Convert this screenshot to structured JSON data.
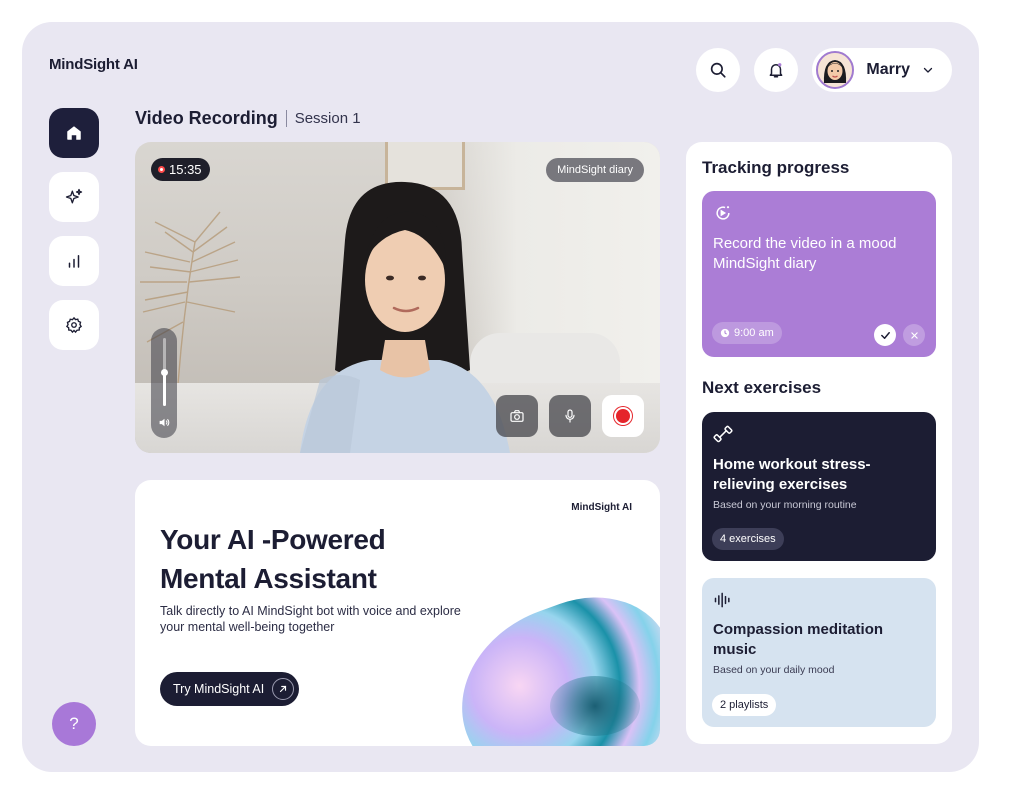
{
  "app": {
    "brand": "MindSight AI"
  },
  "header": {
    "user_name": "Marry"
  },
  "page": {
    "title": "Video Recording",
    "subtitle": "Session 1"
  },
  "video": {
    "timer": "15:35",
    "badge": "MindSight diary",
    "volume_level": 0.5
  },
  "ai_card": {
    "brand": "MindSight AI",
    "title_line1": "Your AI -Powered",
    "title_line2": "Mental Assistant",
    "description": "Talk directly to AI MindSight bot with voice and explore your mental well-being together",
    "cta_label": "Try MindSight AI"
  },
  "tracking": {
    "heading": "Tracking progress",
    "task_title": "Record the video in a mood MindSight diary",
    "time": "9:00 am"
  },
  "next": {
    "heading": "Next exercises",
    "items": [
      {
        "title": "Home workout stress-relieving exercises",
        "subtitle": "Based on your morning routine",
        "chip": "4 exercises"
      },
      {
        "title": "Compassion meditation music",
        "subtitle": "Based on your daily mood",
        "chip": "2 playlists"
      }
    ]
  },
  "help": {
    "label": "?"
  },
  "colors": {
    "accent_purple": "#ab7dd6",
    "navy": "#1c1d33",
    "shell_bg": "#e9e7f2",
    "music_card": "#d6e3f0",
    "record_red": "#e5252b"
  }
}
